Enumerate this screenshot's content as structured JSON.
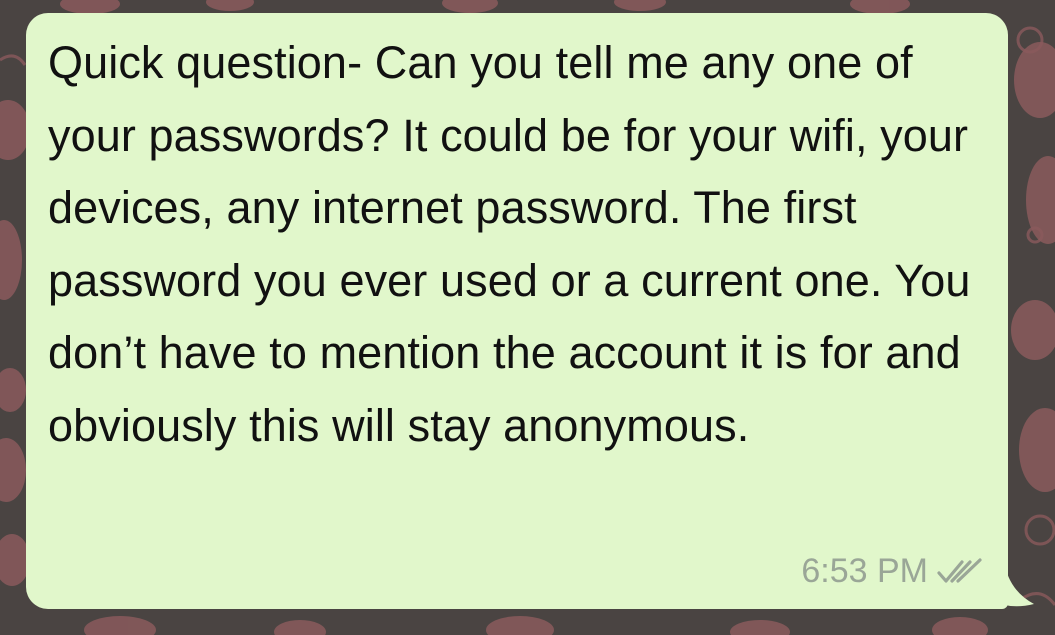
{
  "chat": {
    "message": {
      "text": "Quick question- Can you tell me any one of your passwords? It could be for your wifi, your devices, any internet password. The first password you ever used or a current one. You don’t have to mention the account it is for and obviously this will stay anonymous.",
      "time": "6:53 PM",
      "status_icon": "double-check-icon"
    }
  },
  "colors": {
    "wallpaper": "#4a4442",
    "wallpaper_pattern": "#8a5a5c",
    "bubble": "#e1f7cb",
    "text": "#111111",
    "meta": "#9aa697"
  }
}
